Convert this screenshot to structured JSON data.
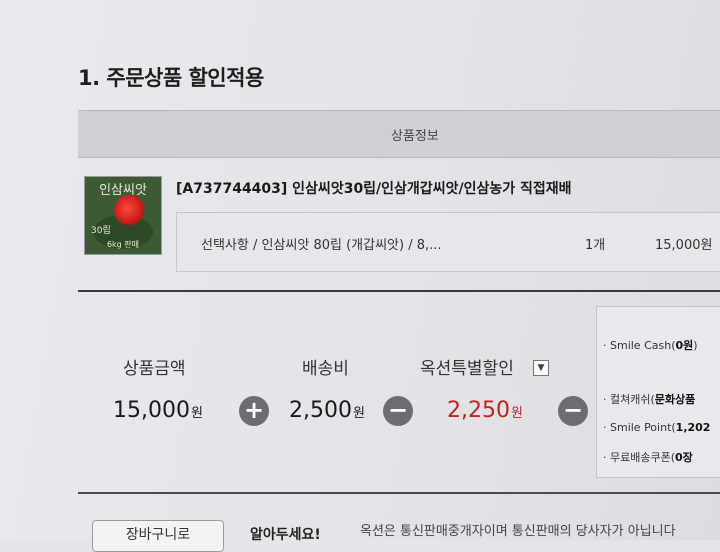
{
  "section": {
    "title": "1. 주문상품 할인적용"
  },
  "product_table": {
    "header": "상품정보",
    "thumbnail": {
      "title": "인삼씨앗",
      "subtitle": "30립",
      "bottom": "6kg 판매"
    },
    "product_name": "[A737744403] 인삼씨앗30립/인삼개갑씨앗/인삼농가 직접재배",
    "option": {
      "text": "선택사항 / 인삼씨앗 80립 (개갑씨앗) / 8,...",
      "quantity": "1개",
      "price": "15,000원"
    }
  },
  "summary": {
    "product_amount": {
      "label": "상품금액",
      "value": "15,000",
      "unit": "원"
    },
    "plus_icon": "plus-circle-icon",
    "shipping": {
      "label": "배송비",
      "value": "2,500",
      "unit": "원"
    },
    "minus_icon": "minus-circle-icon",
    "auction_discount": {
      "label": "옥션특별할인",
      "value": "2,250",
      "unit": "원",
      "dropdown_icon": "chevron-down-icon"
    }
  },
  "payment_panel": {
    "smile_cash": {
      "prefix": "· Smile Cash(",
      "value": "0원",
      "suffix": ")"
    },
    "culture_cash": {
      "prefix": "· 컬쳐캐쉬(",
      "value": "문화상품"
    },
    "smile_point": {
      "prefix": "· Smile Point(",
      "value": "1,202"
    },
    "free_shipping": {
      "prefix": "· 무료배송쿠폰(",
      "value": "0장"
    }
  },
  "footer": {
    "cart_button": "장바구니로",
    "notice_heading": "알아두세요!",
    "notice_text": "옥션은 통신판매중개자이며 통신판매의 당사자가 아닙니다"
  },
  "colors": {
    "discount_red": "#c42020",
    "header_bg": "#cfd0d4",
    "operator_icon": "#6c6d71"
  }
}
